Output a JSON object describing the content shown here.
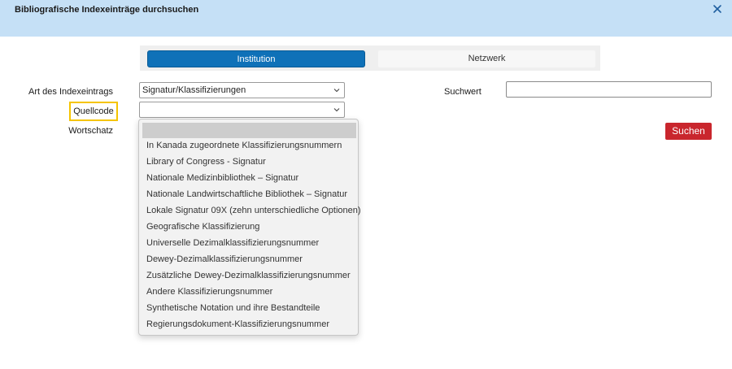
{
  "dialog": {
    "title": "Bibliografische Indexeinträge durchsuchen",
    "close_icon": "close-icon"
  },
  "tabs": [
    {
      "label": "Institution",
      "active": true
    },
    {
      "label": "Netzwerk",
      "active": false
    }
  ],
  "form": {
    "art_label": "Art des Indexeintrags",
    "art_value": "Signatur/Klassifizierungen",
    "quellcode_label": "Quellcode",
    "quellcode_value": "",
    "wortschatz_label": "Wortschatz",
    "suchwert_label": "Suchwert",
    "suchwert_value": ""
  },
  "buttons": {
    "suchen_label": "Suchen"
  },
  "dropdown": {
    "options": [
      "",
      "In Kanada zugeordnete Klassifizierungsnummern",
      "Library of Congress - Signatur",
      "Nationale Medizinbibliothek – Signatur",
      "Nationale Landwirtschaftliche Bibliothek – Signatur",
      "Lokale Signatur 09X (zehn unterschiedliche Optionen)",
      "Geografische Klassifizierung",
      "Universelle Dezimalklassifizierungsnummer",
      "Dewey-Dezimalklassifizierungsnummer",
      "Zusätzliche Dewey-Dezimalklassifizierungsnummer",
      "Andere Klassifizierungsnummer",
      "Synthetische Notation und ihre Bestandteile",
      "Regierungsdokument-Klassifizierungsnummer"
    ]
  },
  "colors": {
    "header_bg": "#c5e0f6",
    "tab_active": "#0f71b8",
    "suchen_button": "#c9262d",
    "highlight_border": "#f5c400"
  }
}
